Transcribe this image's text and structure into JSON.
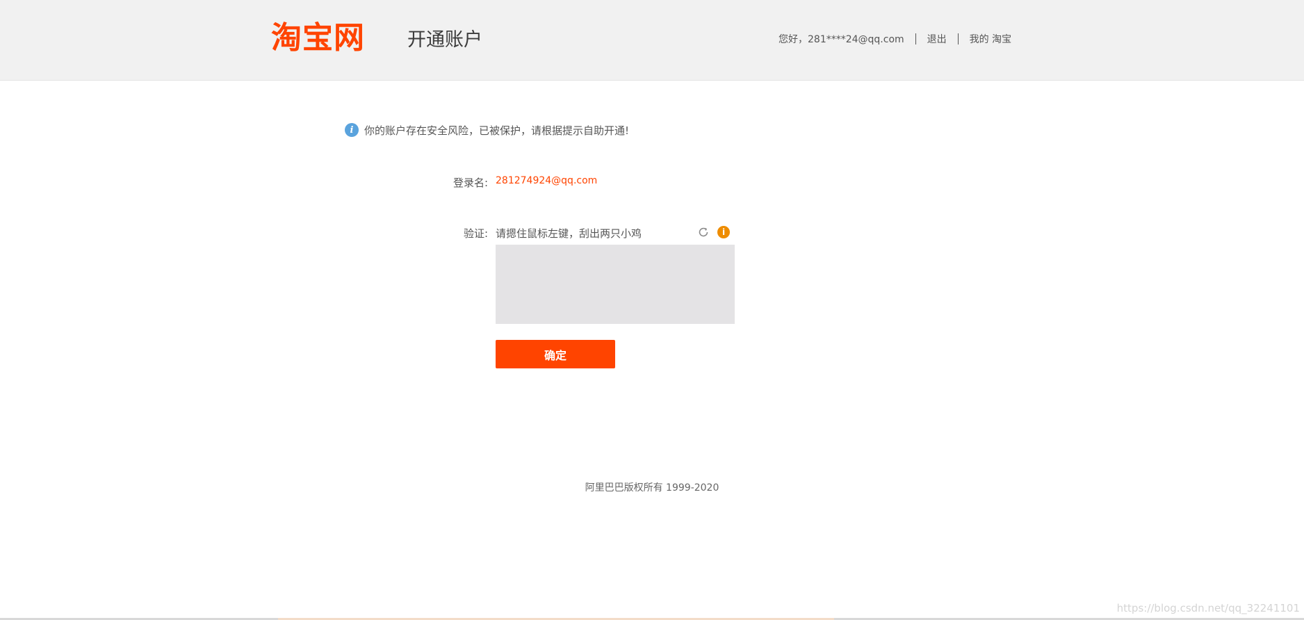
{
  "header": {
    "logo_text": "淘宝网",
    "page_title": "开通账户",
    "greeting": "您好，281****24@qq.com",
    "logout": "退出",
    "my_taobao": "我的 淘宝"
  },
  "notice": {
    "icon": "info-icon",
    "text": "你的账户存在安全风险，已被保护，请根据提示自助开通!"
  },
  "form": {
    "login_label": "登录名:",
    "login_value": "281274924@qq.com",
    "verify_label": "验证:",
    "verify_hint": "请摁住鼠标左键，刮出两只小鸡",
    "refresh_icon": "refresh-icon",
    "help_icon": "help-info-icon",
    "help_glyph": "i",
    "confirm_label": "确定"
  },
  "footer": {
    "copyright": "阿里巴巴版权所有 1999-2020"
  },
  "watermark": "https://blog.csdn.net/qq_32241101",
  "colors": {
    "brand": "#ff4400",
    "header_bg": "#f1f1f1",
    "info_blue": "#5aa3dd",
    "help_orange": "#ee8c00",
    "scratch_bg": "#e4e3e5"
  }
}
